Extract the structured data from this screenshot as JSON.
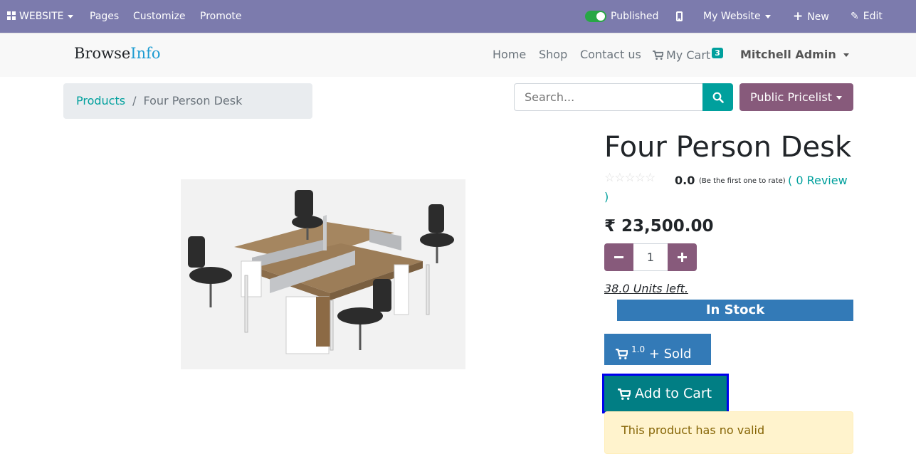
{
  "adminbar": {
    "website_menu": "WEBSITE",
    "pages": "Pages",
    "customize": "Customize",
    "promote": "Promote",
    "published": "Published",
    "my_website": "My Website",
    "new": "New",
    "edit": "Edit"
  },
  "header": {
    "brand_part1": "Browse",
    "brand_part2": "Info",
    "nav": [
      "Home",
      "Shop",
      "Contact us"
    ],
    "cart_label": "My Cart",
    "cart_count": "3",
    "user": "Mitchell Admin"
  },
  "breadcrumb": {
    "parent": "Products",
    "separator": "/",
    "current": "Four Person Desk"
  },
  "search": {
    "placeholder": "Search..."
  },
  "pricelist": "Public Pricelist",
  "product": {
    "title": "Four Person Desk",
    "rating_value": "0.0",
    "rating_note": "(Be the first one to rate)",
    "review_link": "( 0 Review",
    "review_close": ")",
    "price": "₹ 23,500.00",
    "quantity": "1",
    "units_left": "38.0 Units left.",
    "stock_status": "In Stock",
    "sold_count": "1.0",
    "sold_label": "+ Sold",
    "add_to_cart": "Add to Cart",
    "warning": "This product has no valid"
  },
  "colors": {
    "adminbar": "#7c7bad",
    "primary": "#00a09d",
    "secondary": "#875a7b",
    "info": "#337ab7",
    "cart_button": "#017e84"
  }
}
